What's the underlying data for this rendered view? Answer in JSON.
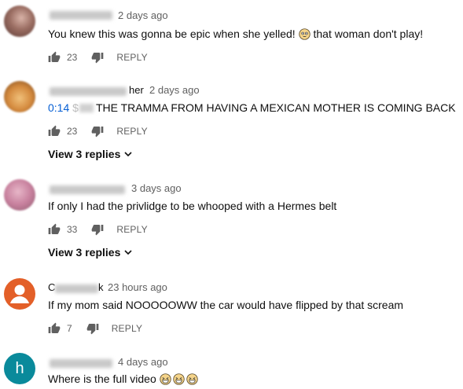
{
  "comments": [
    {
      "time": "2 days ago",
      "text_before": "You knew this was gonna be epic when she yelled! ",
      "text_after": " that woman don't play!",
      "likes": "23",
      "reply_label": "REPLY"
    },
    {
      "name_suffix": "her",
      "time": "2 days ago",
      "timestamp_link": "0:14",
      "text_prefix": "$",
      "text": "THE TRAMMA FROM HAVING A MEXICAN MOTHER IS COMING BACK",
      "likes": "23",
      "reply_label": "REPLY",
      "view_replies": "View 3 replies"
    },
    {
      "time": "3 days ago",
      "text": "If only I had the privlidge to be whooped with a Hermes belt",
      "likes": "33",
      "reply_label": "REPLY",
      "view_replies": "View 3 replies"
    },
    {
      "name_prefix": "C",
      "name_suffix": "k",
      "time": "23 hours ago",
      "text": "If my mom said NOOOOOWW the car would have flipped by that scream",
      "likes": "7",
      "reply_label": "REPLY"
    },
    {
      "avatar_letter": "h",
      "time": "4 days ago",
      "text": "Where is the full video "
    }
  ],
  "icons": {
    "like": "thumb-up-icon",
    "dislike": "thumb-down-icon",
    "expand": "chevron-down-icon",
    "emoji_flushed": "flushed-face-emoji",
    "emoji_laugh": "grinning-squinting-face-emoji"
  },
  "colors": {
    "link": "#065fd4",
    "meta": "#606060",
    "text": "#0f0f0f"
  }
}
